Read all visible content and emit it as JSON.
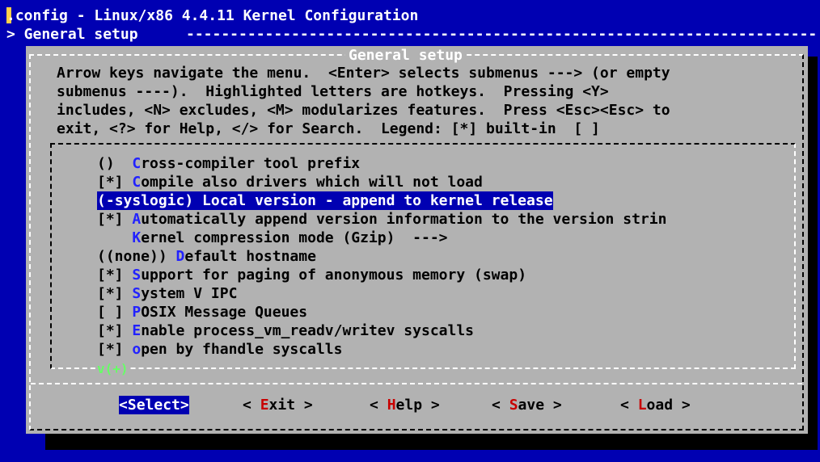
{
  "window": {
    "title": ".config - Linux/x86 4.4.11 Kernel Configuration",
    "breadcrumb": "> General setup",
    "breadcrumb_rule": "--------------------------------------------------------------------------------------------------------------------"
  },
  "dialog": {
    "title": "General setup",
    "help_lines": [
      "Arrow keys navigate the menu.  <Enter> selects submenus ---> (or empty",
      "submenus ----).  Highlighted letters are hotkeys.  Pressing <Y>",
      "includes, <N> excludes, <M> modularizes features.  Press <Esc><Esc> to",
      "exit, <?> for Help, </> for Search.  Legend: [*] built-in  [ ]"
    ],
    "more_indicator": "v(+)"
  },
  "menu": {
    "items": [
      {
        "prefix": "()  ",
        "hotkey": "C",
        "rest": "ross-compiler tool prefix",
        "selected": false
      },
      {
        "prefix": "[*] ",
        "hotkey": "C",
        "rest": "ompile also drivers which will not load",
        "selected": false
      },
      {
        "prefix": "(",
        "hotkey": "-",
        "rest": "syslogic) Local version - append to kernel release",
        "selected": true
      },
      {
        "prefix": "[*] ",
        "hotkey": "A",
        "rest": "utomatically append version information to the version strin",
        "selected": false
      },
      {
        "prefix": "    ",
        "hotkey": "K",
        "rest": "ernel compression mode (Gzip)  --->",
        "selected": false
      },
      {
        "prefix": "((none)) ",
        "hotkey": "D",
        "rest": "efault hostname",
        "selected": false
      },
      {
        "prefix": "[*] ",
        "hotkey": "S",
        "rest": "upport for paging of anonymous memory (swap)",
        "selected": false
      },
      {
        "prefix": "[*] ",
        "hotkey": "S",
        "rest": "ystem V IPC",
        "selected": false
      },
      {
        "prefix": "[ ] ",
        "hotkey": "P",
        "rest": "OSIX Message Queues",
        "selected": false
      },
      {
        "prefix": "[*] ",
        "hotkey": "E",
        "rest": "nable process_vm_readv/writev syscalls",
        "selected": false
      },
      {
        "prefix": "[*] ",
        "hotkey": "o",
        "rest": "pen by fhandle syscalls",
        "selected": false
      }
    ]
  },
  "buttons": [
    {
      "left": "<",
      "hotkey": "S",
      "rest": "elect",
      "right": ">",
      "selected": true
    },
    {
      "left": "< ",
      "hotkey": "E",
      "rest": "xit",
      "right": " >",
      "selected": false
    },
    {
      "left": "< ",
      "hotkey": "H",
      "rest": "elp",
      "right": " >",
      "selected": false
    },
    {
      "left": "< ",
      "hotkey": "S",
      "rest": "ave",
      "right": " >",
      "selected": false
    },
    {
      "left": "< ",
      "hotkey": "L",
      "rest": "oad",
      "right": " >",
      "selected": false
    }
  ],
  "colors": {
    "background": "#0000b2",
    "dialog": "#b2b2b2",
    "hotkey_menu": "#2222ff",
    "hotkey_button": "#c80000",
    "more_indicator": "#66ff66"
  }
}
